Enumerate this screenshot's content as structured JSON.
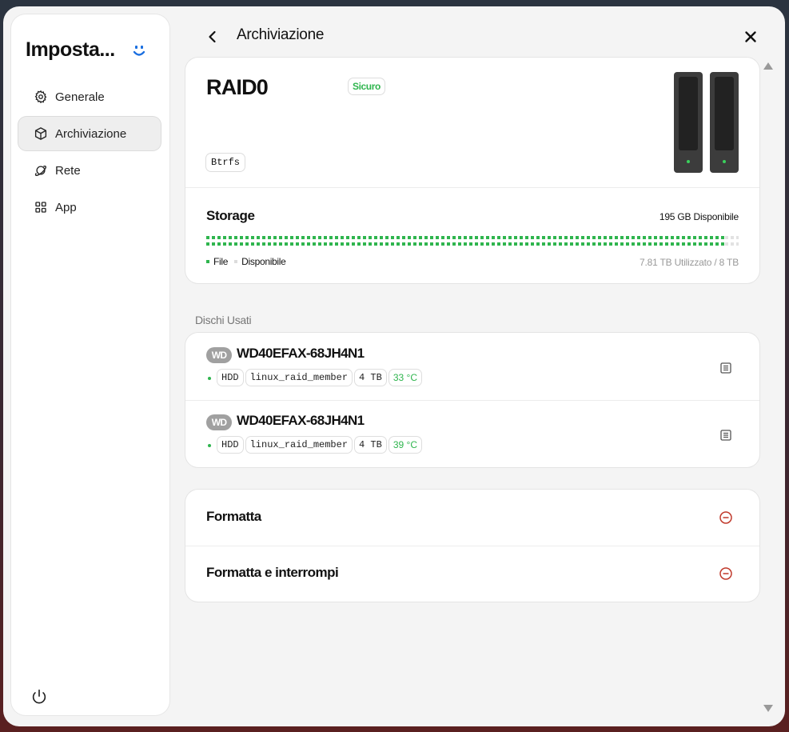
{
  "sidebar": {
    "title": "Imposta...",
    "items": [
      {
        "label": "Generale",
        "icon": "gear-icon"
      },
      {
        "label": "Archiviazione",
        "icon": "cube-icon",
        "active": true
      },
      {
        "label": "Rete",
        "icon": "planet-icon"
      },
      {
        "label": "App",
        "icon": "grid-icon"
      }
    ]
  },
  "header": {
    "title": "Archiviazione"
  },
  "raid": {
    "name": "RAID0",
    "status": "Sicuro",
    "filesystem": "Btrfs"
  },
  "storage": {
    "label": "Storage",
    "available": "195 GB Disponibile",
    "used_fraction": 0.975,
    "legend_used": "File",
    "legend_free": "Disponibile",
    "usage": "7.81 TB Utilizzato / 8 TB"
  },
  "disks_section": {
    "title": "Dischi Usati"
  },
  "disks": [
    {
      "logo": "WD",
      "name": "WD40EFAX-68JH4N1",
      "tags": [
        "HDD",
        "linux_raid_member",
        "4 TB"
      ],
      "temp": "33 °C"
    },
    {
      "logo": "WD",
      "name": "WD40EFAX-68JH4N1",
      "tags": [
        "HDD",
        "linux_raid_member",
        "4 TB"
      ],
      "temp": "39 °C"
    }
  ],
  "actions": [
    {
      "label": "Formatta"
    },
    {
      "label": "Formatta e interrompi"
    }
  ],
  "colors": {
    "accent_green": "#2fb54e",
    "danger_red": "#c0392b",
    "brand_blue": "#1b6fe0"
  }
}
